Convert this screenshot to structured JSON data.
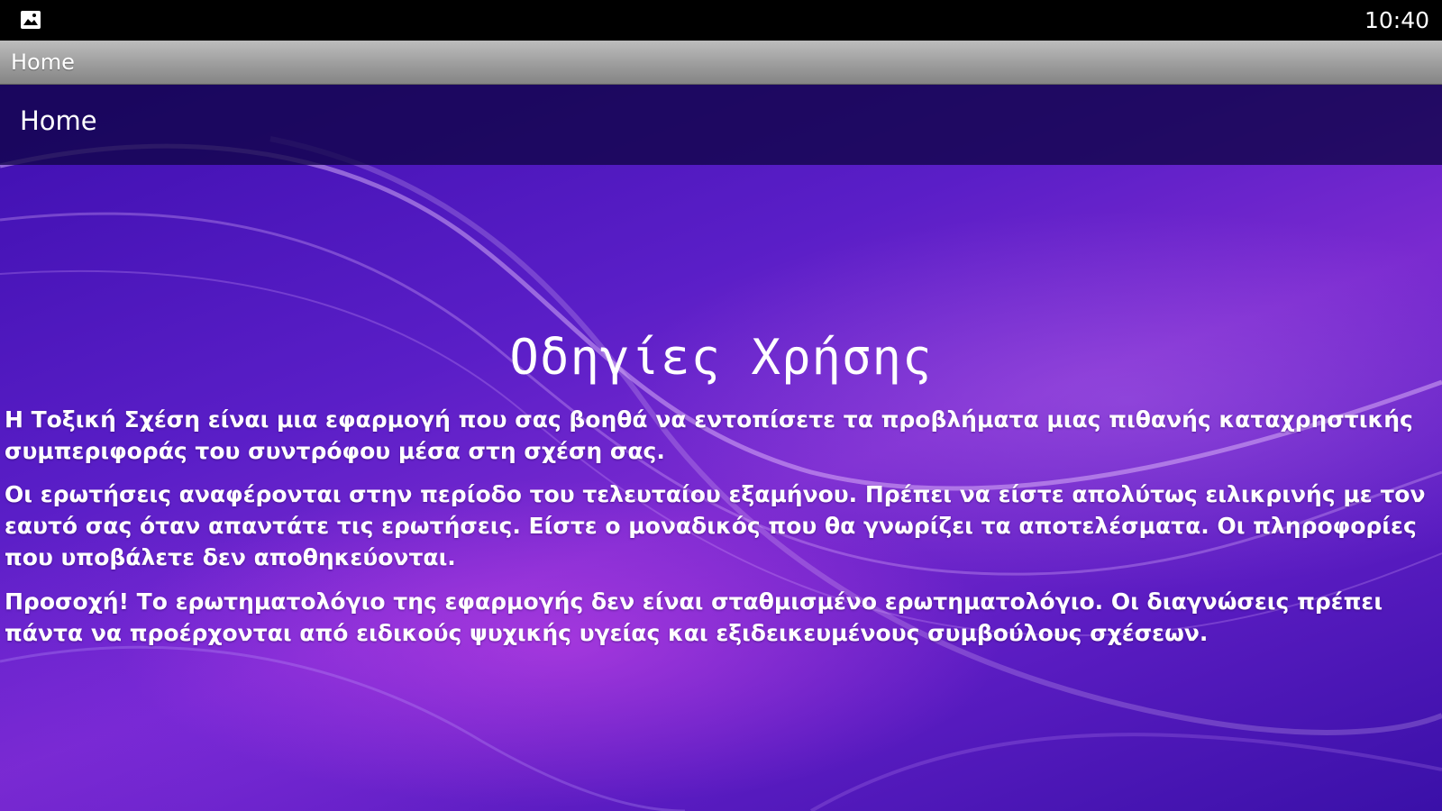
{
  "status_bar": {
    "left_icon": "image-icon",
    "time": "10:40"
  },
  "title_bar": {
    "title": "Home"
  },
  "content": {
    "header_title": "Home",
    "page_title": "Οδηγίες Χρήσης",
    "paragraphs": [
      "Η Τοξική Σχέση είναι μια εφαρμογή που σας βοηθά να εντοπίσετε τα προβλήματα μιας πιθανής καταχρηστικής συμπεριφοράς του συντρόφου μέσα στη σχέση σας.",
      "Οι ερωτήσεις αναφέρονται στην περίοδο του τελευταίου εξαμήνου. Πρέπει να είστε απολύτως ειλικρινής με τον εαυτό σας όταν απαντάτε τις ερωτήσεις. Είστε ο μοναδικός που θα γνωρίζει τα αποτελέσματα. Οι πληροφορίες που υποβάλετε δεν αποθηκεύονται.",
      "Προσοχή! Το ερωτηματολόγιο της εφαρμογής δεν είναι σταθμισμένο ερωτηματολόγιο. Οι διαγνώσεις πρέπει πάντα να προέρχονται από ειδικούς ψυχικής υγείας και εξιδεικευμένους συμβούλους σχέσεων."
    ]
  },
  "colors": {
    "status_bar": "#000000",
    "title_bar": "#9d9d9d",
    "header_band": "#10044a",
    "background_primary": "#5a1ec7",
    "background_accent": "#cd46eb",
    "text": "#ffffff"
  }
}
